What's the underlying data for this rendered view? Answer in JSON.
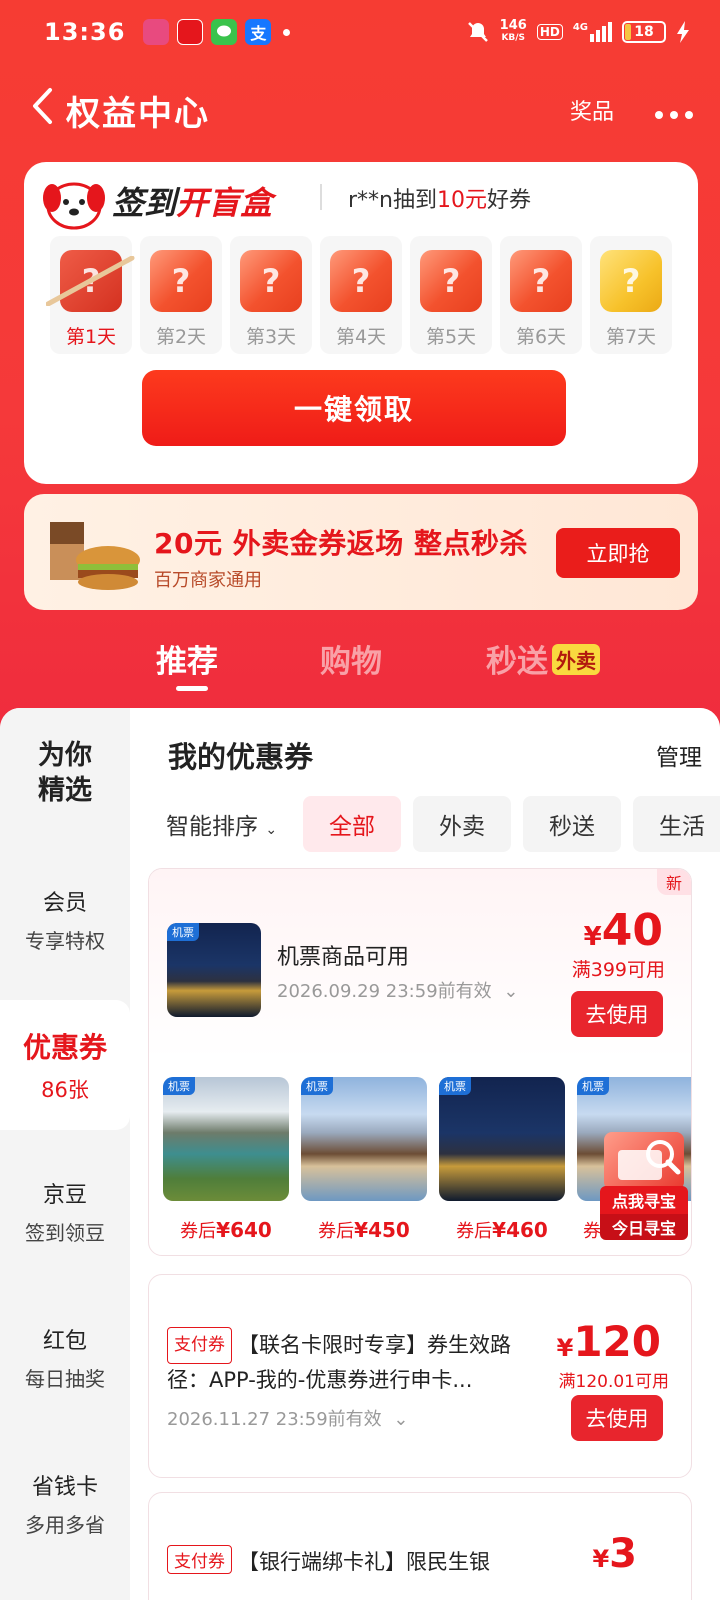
{
  "status_bar": {
    "time": "13:36",
    "app_icons": [
      {
        "name": "app-icon-1",
        "text": "",
        "color": "#e84a7f"
      },
      {
        "name": "app-icon-2",
        "text": "",
        "color": "#e5161c"
      },
      {
        "name": "messages-icon",
        "text": "",
        "color": "#3ac34c"
      },
      {
        "name": "alipay-icon",
        "text": "支",
        "color": "#1677ff"
      }
    ],
    "speed": "146",
    "speed_unit": "KB/S",
    "hd": "HD",
    "network": "4G",
    "battery": "18"
  },
  "header": {
    "back_icon": "chevron-left-icon",
    "title": "权益中心",
    "prize_label": "奖品",
    "more_icon": "more-dots-icon"
  },
  "signin": {
    "title_part1": "签到",
    "title_part2": "开盲盒",
    "msg_user": "r**n抽到",
    "msg_amount": "10元",
    "msg_suffix": "好券",
    "days": [
      "第1天",
      "第2天",
      "第3天",
      "第4天",
      "第5天",
      "第6天",
      "第7天"
    ],
    "button": "一键领取"
  },
  "promo": {
    "title": "20元 外卖金券返场 整点秒杀",
    "subtitle": "百万商家通用",
    "button": "立即抢"
  },
  "tabs": {
    "recommend": "推荐",
    "shopping": "购物",
    "delivery": "秒送",
    "delivery_badge": "外卖"
  },
  "sidebar": {
    "featured": "为你精选",
    "items": [
      {
        "l1": "会员",
        "l2": "专享特权"
      },
      {
        "l1": "优惠券",
        "l2": "86张"
      },
      {
        "l1": "京豆",
        "l2": "签到领豆"
      },
      {
        "l1": "红包",
        "l2": "每日抽奖"
      },
      {
        "l1": "省钱卡",
        "l2": "多用多省"
      }
    ]
  },
  "coupons": {
    "title": "我的优惠券",
    "manage": "管理",
    "sort": "智能排序",
    "filters": [
      "全部",
      "外卖",
      "秒送",
      "生活"
    ]
  },
  "coupon1": {
    "badge": "新",
    "thumb_tag": "机票",
    "name": "机票商品可用",
    "expiry": "2026.09.29 23:59前有效",
    "currency": "¥",
    "amount": "40",
    "condition": "满399可用",
    "button": "去使用",
    "products": [
      {
        "tag": "机票",
        "prefix": "券后",
        "price": "¥640"
      },
      {
        "tag": "机票",
        "prefix": "券后",
        "price": "¥450"
      },
      {
        "tag": "机票",
        "prefix": "券后",
        "price": "¥460"
      },
      {
        "tag": "机票",
        "prefix": "券",
        "price": ""
      }
    ]
  },
  "float_widget": {
    "line1": "点我寻宝",
    "line2": "今日寻宝"
  },
  "coupon2": {
    "tag": "支付券",
    "text": "【联名卡限时专享】券生效路径：APP-我的-优惠券进行申卡...",
    "expiry": "2026.11.27 23:59前有效",
    "currency": "¥",
    "amount": "120",
    "condition": "满120.01可用",
    "button": "去使用"
  },
  "coupon3": {
    "tag": "支付券",
    "text": "【银行端绑卡礼】限民生银",
    "currency": "¥",
    "amount": "3"
  }
}
